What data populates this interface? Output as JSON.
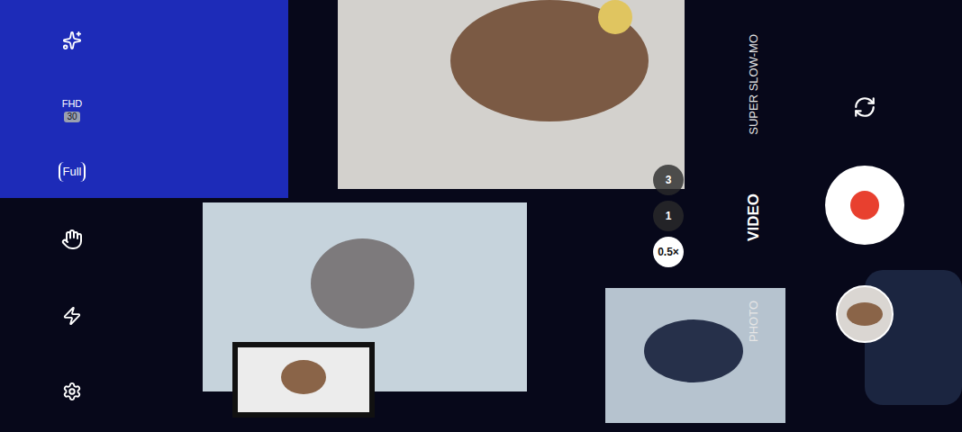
{
  "screen": {
    "kind": "camera-viewfinder"
  },
  "quick_settings": {
    "resolution": "FHD",
    "fps": "30",
    "aspect": "Full"
  },
  "zoom": [
    {
      "label": "3",
      "selected": false
    },
    {
      "label": "1",
      "selected": false
    },
    {
      "label": "0.5×",
      "selected": true
    }
  ],
  "modes": [
    {
      "label": "SUPER SLOW-MO",
      "selected": false
    },
    {
      "label": "VIDEO",
      "selected": true
    },
    {
      "label": "PHOTO",
      "selected": false
    }
  ]
}
